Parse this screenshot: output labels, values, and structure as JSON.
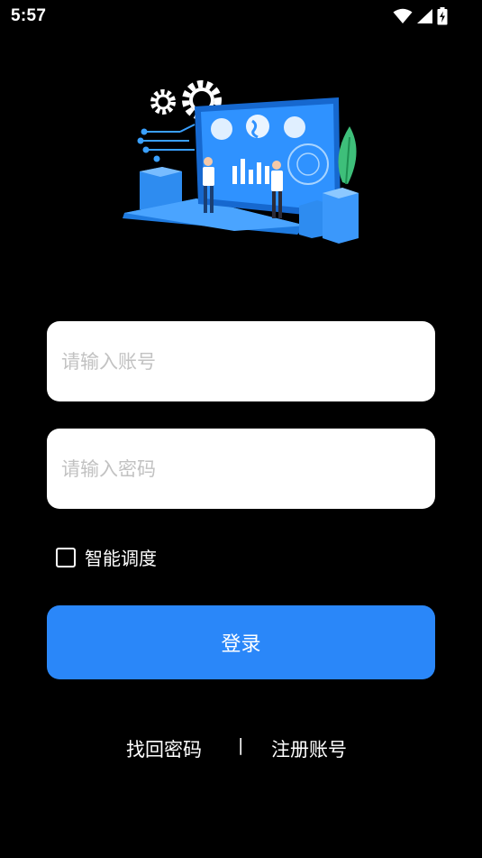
{
  "status_bar": {
    "time": "5:57",
    "icons": [
      "wifi-icon",
      "cellular-signal-icon",
      "battery-charging-icon"
    ]
  },
  "hero": {
    "illustration": "laptop-data-analytics-illustration"
  },
  "form": {
    "account": {
      "placeholder": "请输入账号",
      "value": ""
    },
    "password": {
      "placeholder": "请输入密码",
      "value": ""
    },
    "smart_dispatch": {
      "label": "智能调度",
      "checked": false
    },
    "login_label": "登录"
  },
  "links": {
    "forgot_password": "找回密码",
    "separator": "|",
    "register": "注册账号"
  },
  "colors": {
    "background": "#000000",
    "primary": "#2a87f9",
    "input_background": "#ffffff",
    "placeholder": "#c2c2c2"
  }
}
